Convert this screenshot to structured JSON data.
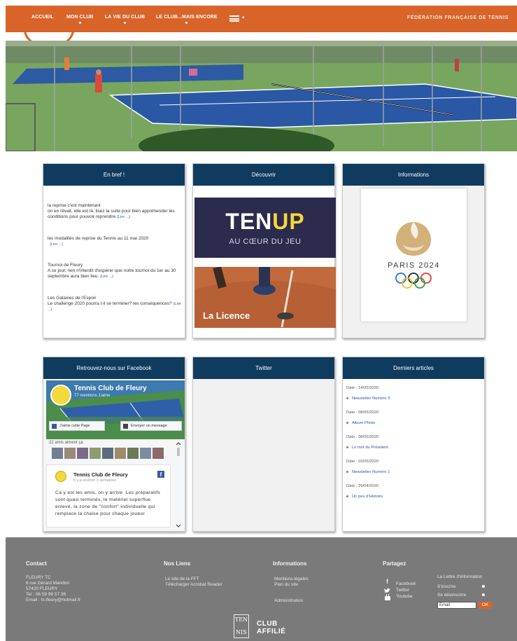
{
  "nav": {
    "items": [
      {
        "label": "ACCUEIL"
      },
      {
        "label": "MON CLUB"
      },
      {
        "label": "LA VIE DU CLUB"
      },
      {
        "label": "LE CLUB...MAIS ENCORE"
      }
    ],
    "federation": "FÉDÉRATION FRANÇAISE DE TENNIS"
  },
  "panels": {
    "bref": {
      "title": "En bref !",
      "items": [
        {
          "title": "la reprise c'est maintenant",
          "text": "on en rêvait, elle est là. lisez la suite pour bien appréhender les conditions pour pouvoir reprendre",
          "more": "(Lire ...)"
        },
        {
          "title": "les modalités de reprise du Tennis au 11 mai 2020",
          "text": "",
          "more": "(Lire ...)"
        },
        {
          "title": "Tournoi de Fleury",
          "text": "A ce jour, rien n'interdit d'espérer que notre tournoi du 1er au 30 septembre aura bien lieu.",
          "more": "(Lire ...)"
        },
        {
          "title": "Les Galaxies de l'Espoir",
          "text": "Le challenge 2020 pourra t-il se terminer? les conséquences?",
          "more": "(Lire ...)"
        }
      ]
    },
    "decouvrir": {
      "title": "Découvrir",
      "tenup_ten": "TEN",
      "tenup_up": "UP",
      "tenup_sub": "AU CŒUR DU JEU",
      "licence": "La Licence"
    },
    "informations": {
      "title": "Informations",
      "paris": "PARIS 2024"
    },
    "facebook": {
      "title": "Retrouvez-nous sur Facebook",
      "page_name": "Tennis Club de Fleury",
      "likes": "77 mentions J'aime",
      "like_button": "J'aime cette Page",
      "message_button": "Envoyer un message",
      "friends": "22 amis aiment ça",
      "post_name": "Tennis Club de Fleury",
      "post_time": "Il y a environ 3 semaines",
      "post_text": "Ca y est les amis, on y arrive. Les préparatifs sont quasi terminés, le matériel superflue enlevé, la zone de \"confort\" individuelle qui remplace la chaise pour chaque joueur"
    },
    "twitter": {
      "title": "Twitter"
    },
    "articles": {
      "title": "Derniers articles",
      "items": [
        {
          "date": "Date : 14/05/2020",
          "title": "Newsletter Numéro 3"
        },
        {
          "date": "Date : 08/05/2020",
          "title": "Album Photo"
        },
        {
          "date": "Date : 08/05/2020",
          "title": "Le mot du Président"
        },
        {
          "date": "Date : 03/05/2020",
          "title": "Newsletter Numéro 1"
        },
        {
          "date": "Date : 29/04/2020",
          "title": "Un peu d'Histoire"
        }
      ]
    }
  },
  "footer": {
    "contact": {
      "heading": "Contact",
      "lines": [
        "FLEURY TC",
        "6 rue Gérard Mandon",
        "57420 FLEURY",
        "Tel : 06 59 99 57 36",
        "Email : tc-fleury@hotmail.fr"
      ]
    },
    "liens": {
      "heading": "Nos Liens",
      "items": [
        "Le site de la FFT",
        "Télécharger Acrobat Reader"
      ]
    },
    "informations": {
      "heading": "Informations",
      "items": [
        "Mentions légales",
        "Plan du site",
        "Administration"
      ]
    },
    "partagez": {
      "heading": "Partagez",
      "items": [
        "Facebook",
        "Twitter",
        "Youtube"
      ]
    },
    "newsletter": {
      "heading": "La Lettre d'information",
      "subscribe": "S'inscrire",
      "unsubscribe": "Se désinscrire",
      "email_placeholder": "Email",
      "ok": "OK"
    },
    "club": {
      "logo_top": "TEN",
      "logo_bottom": "NIS",
      "line1": "CLUB",
      "line2": "AFFILIÉ"
    }
  }
}
